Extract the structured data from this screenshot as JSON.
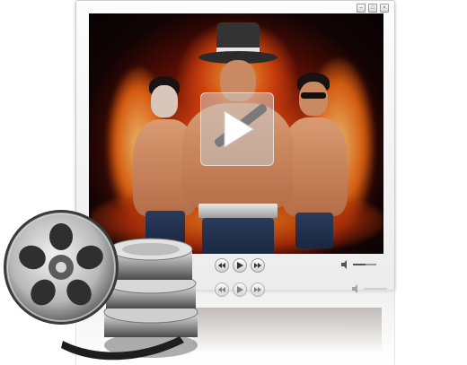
{
  "window": {
    "buttons": [
      "minimize-icon",
      "maximize-icon",
      "close-icon"
    ]
  },
  "video": {
    "overlay_icon": "play-icon",
    "scene": "three-men-fire-poster"
  },
  "controls": {
    "buttons": [
      "rewind-icon",
      "play-icon",
      "fast-forward-icon"
    ],
    "volume_icon": "speaker-icon",
    "volume_level": 0.55
  },
  "decor": {
    "icon": "film-reel-icon"
  },
  "colors": {
    "fire_core": "#f7a020",
    "fire_edge": "#5a0d05",
    "window_bg": "#f2f2f2",
    "reel_metal": "#9a9a9a"
  }
}
